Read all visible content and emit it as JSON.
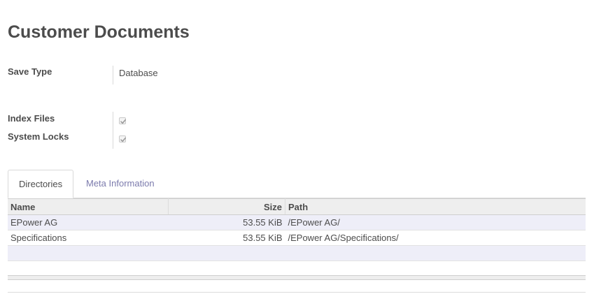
{
  "page": {
    "title": "Customer Documents"
  },
  "fields": {
    "save_type": {
      "label": "Save Type",
      "value": "Database"
    },
    "index_files": {
      "label": "Index Files",
      "checked": true
    },
    "system_locks": {
      "label": "System Locks",
      "checked": true
    }
  },
  "tabs": [
    {
      "label": "Directories",
      "active": true
    },
    {
      "label": "Meta Information",
      "active": false
    }
  ],
  "table": {
    "columns": [
      "Name",
      "Size",
      "Path"
    ],
    "rows": [
      {
        "name": "EPower AG",
        "size": "53.55 KiB",
        "path": "/EPower AG/"
      },
      {
        "name": "Specifications",
        "size": "53.55 KiB",
        "path": "/EPower AG/Specifications/"
      }
    ]
  },
  "colors": {
    "accent": "#7c7bad",
    "text": "#4c4c4c",
    "header_bg": "#eeeeee",
    "row_alt_bg": "#eeeef8"
  },
  "icons": {
    "checkbox_check": "check-icon"
  }
}
